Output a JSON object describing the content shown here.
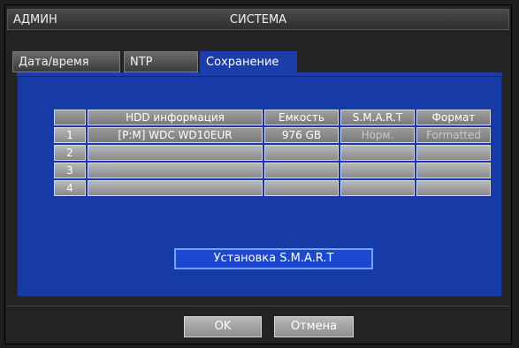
{
  "header": {
    "left_label": "АДМИН",
    "title": "СИСТЕМА"
  },
  "tabs": [
    {
      "label": "Дата/время"
    },
    {
      "label": "NTP"
    },
    {
      "label": "Сохранение"
    }
  ],
  "table": {
    "columns": [
      "HDD информация",
      "Емкость",
      "S.M.A.R.T",
      "Формат"
    ],
    "rows": [
      {
        "idx": "1",
        "hdd": "[P:M] WDC WD10EUR",
        "capacity": "976 GB",
        "smart": "Норм.",
        "format": "Formatted"
      },
      {
        "idx": "2",
        "hdd": "",
        "capacity": "",
        "smart": "",
        "format": ""
      },
      {
        "idx": "3",
        "hdd": "",
        "capacity": "",
        "smart": "",
        "format": ""
      },
      {
        "idx": "4",
        "hdd": "",
        "capacity": "",
        "smart": "",
        "format": ""
      }
    ]
  },
  "buttons": {
    "smart_setup": "Установка S.M.A.R.T",
    "ok": "OK",
    "cancel": "Отмена"
  }
}
